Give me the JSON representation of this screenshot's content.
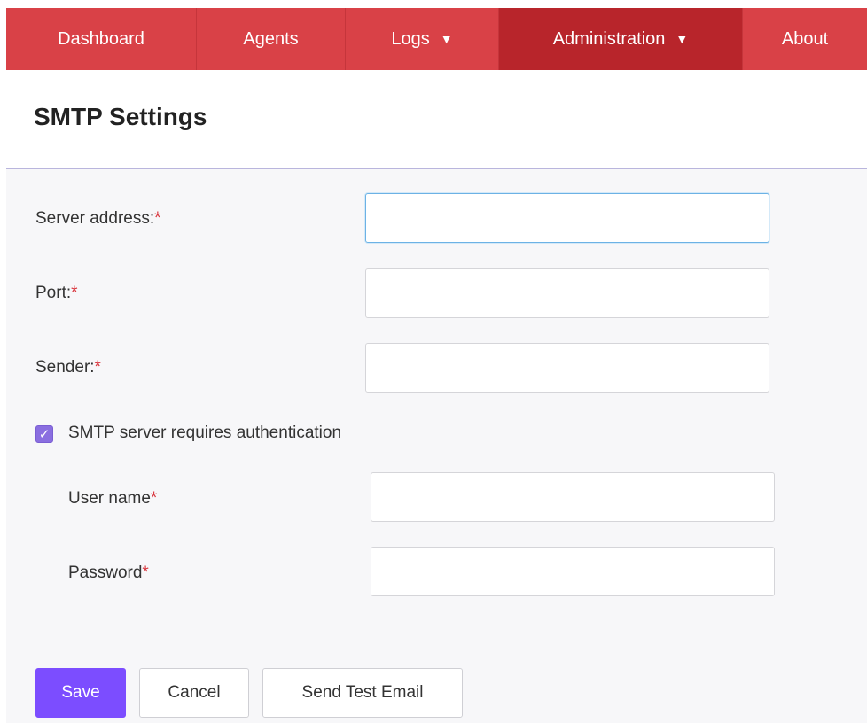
{
  "nav": {
    "items": [
      {
        "label": "Dashboard"
      },
      {
        "label": "Agents"
      },
      {
        "label": "Logs"
      },
      {
        "label": "Administration"
      },
      {
        "label": "About"
      }
    ],
    "caret": "▼",
    "active": "Administration"
  },
  "page": {
    "title": "SMTP Settings"
  },
  "form": {
    "required_mark": "*",
    "server_address": {
      "label": "Server address:",
      "value": ""
    },
    "port": {
      "label": "Port:",
      "value": ""
    },
    "sender": {
      "label": "Sender:",
      "value": ""
    },
    "auth_checkbox": {
      "label": "SMTP server requires authentication",
      "checked": true,
      "check_glyph": "✓"
    },
    "user_name": {
      "label": "User name",
      "value": ""
    },
    "password": {
      "label": "Password",
      "value": ""
    }
  },
  "actions": {
    "save_label": "Save",
    "cancel_label": "Cancel",
    "test_label": "Send Test Email"
  },
  "colors": {
    "nav_bg": "#d94147",
    "nav_active": "#b8252b",
    "primary": "#7c4dff",
    "checkbox": "#8a6ee0",
    "required": "#d9363e"
  }
}
